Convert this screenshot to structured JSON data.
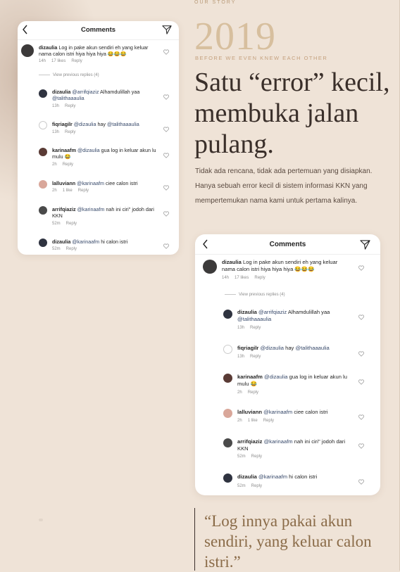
{
  "story": {
    "kicker": "OUR STORY",
    "year": "2019",
    "subkicker": "BEFORE WE EVEN KNEW EACH OTHER",
    "headline": "Satu “error” kecil, membuka jalan pulang.",
    "body": "Tidak ada rencana, tidak ada pertemuan yang disiapkan. Hanya sebuah error kecil di sistem informasi KKN yang mempertemukan nama kami untuk pertama kalinya.",
    "quote": "“Log innya pakai akun sendiri, yang keluar calon istri.”"
  },
  "comments_panel": {
    "title": "Comments",
    "view_replies": "View previous replies (4)",
    "reply_label": "Reply",
    "items": [
      {
        "user": "dizaulia",
        "text": "Log in pake akun sendiri eh yang keluar nama calon istri hiya hiya hiya 😂😂😂",
        "time": "14h",
        "likes": "17 likes"
      },
      {
        "user": "dizaulia",
        "mention": "@arrifqiaziz",
        "text": "Alhamdulillah yaa",
        "mention2": "@talithaaaulia",
        "time": "13h",
        "likes": ""
      },
      {
        "user": "fiqriagilr",
        "mention": "@dizaulia",
        "text": "hay",
        "mention2": "@talithaaaulia",
        "time": "13h",
        "likes": ""
      },
      {
        "user": "karinaafm",
        "mention": "@dizaulia",
        "text": "gua log in keluar akun lu mulu 😂",
        "time": "2h",
        "likes": ""
      },
      {
        "user": "lalluviann",
        "mention": "@karinaafm",
        "text": "ciee calon istri",
        "time": "2h",
        "likes": "1 like"
      },
      {
        "user": "arrifqiaziz",
        "mention": "@karinaafm",
        "text": "nah ini ciri\" jodoh dari KKN",
        "time": "52m",
        "likes": ""
      },
      {
        "user": "dizaulia",
        "mention": "@karinaafm",
        "text": "hi calon istri",
        "time": "52m",
        "likes": ""
      }
    ]
  },
  "colors": {
    "background": "#efe3d7",
    "year": "#d7bf9e",
    "accent": "#c4a17e",
    "quote": "#8a6b48"
  },
  "icons": [
    "back-chevron-icon",
    "send-icon",
    "heart-icon",
    "avatar"
  ]
}
